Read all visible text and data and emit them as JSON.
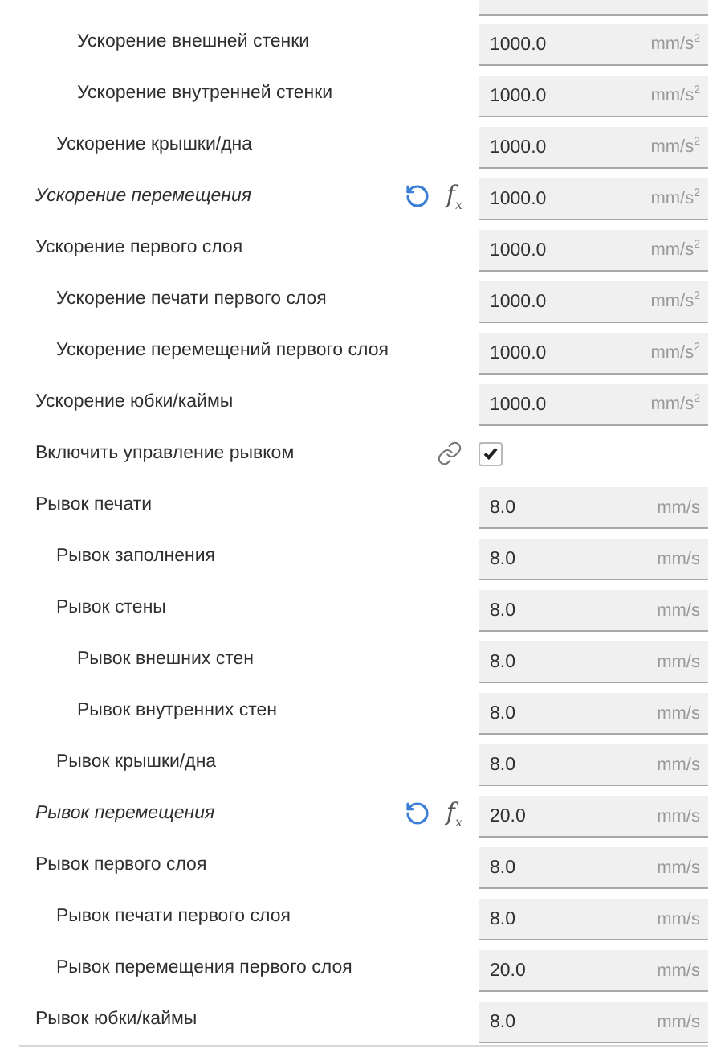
{
  "settings": [
    {
      "children": [
        {
          "children": [
            {
              "label": "Ускорение внешней стенки",
              "value": "1000.0",
              "unit": "mm/s$^{2}$"
            },
            {
              "label": "Ускорение внутренней стенки",
              "value": "1000.0",
              "unit": "mm/s$^{2}$"
            }
          ]
        },
        {
          "label": "Ускорение крышки/дна",
          "value": "1000.0",
          "unit": "mm/s$^{2}$"
        }
      ]
    },
    {
      "label": "Ускорение перемещения",
      "modified": true,
      "formula": "f$_{x}$",
      "value": "1000.0",
      "unit": "mm/s$^{2}$"
    },
    {
      "label": "Ускорение первого слоя",
      "value": "1000.0",
      "unit": "mm/s$^{2}$",
      "children": [
        {
          "label": "Ускорение печати первого слоя",
          "value": "1000.0",
          "unit": "mm/s$^{2}$"
        },
        {
          "label": "Ускорение перемещений первого слоя",
          "value": "1000.0",
          "unit": "mm/s$^{2}$"
        }
      ]
    },
    {
      "label": "Ускорение юбки/каймы",
      "value": "1000.0",
      "unit": "mm/s$^{2}$"
    },
    {
      "label": "Включить управление рывком",
      "kind": "checkbox",
      "checked": true,
      "linked": true
    },
    {
      "label": "Рывок печати",
      "value": "8.0",
      "unit": "mm/s",
      "children": [
        {
          "label": "Рывок заполнения",
          "value": "8.0",
          "unit": "mm/s"
        },
        {
          "label": "Рывок стены",
          "value": "8.0",
          "unit": "mm/s",
          "children": [
            {
              "label": "Рывок внешних стен",
              "value": "8.0",
              "unit": "mm/s"
            },
            {
              "label": "Рывок внутренних стен",
              "value": "8.0",
              "unit": "mm/s"
            }
          ]
        },
        {
          "label": "Рывок крышки/дна",
          "value": "8.0",
          "unit": "mm/s"
        }
      ]
    },
    {
      "label": "Рывок перемещения",
      "modified": true,
      "formula": "f$_{x}$",
      "value": "20.0",
      "unit": "mm/s"
    },
    {
      "label": "Рывок первого слоя",
      "value": "8.0",
      "unit": "mm/s",
      "children": [
        {
          "label": "Рывок печати первого слоя",
          "value": "8.0",
          "unit": "mm/s"
        },
        {
          "label": "Рывок перемещения первого слоя",
          "value": "20.0",
          "unit": "mm/s"
        }
      ]
    },
    {
      "label": "Рывок юбки/каймы",
      "value": "8.0",
      "unit": "mm/s"
    }
  ]
}
